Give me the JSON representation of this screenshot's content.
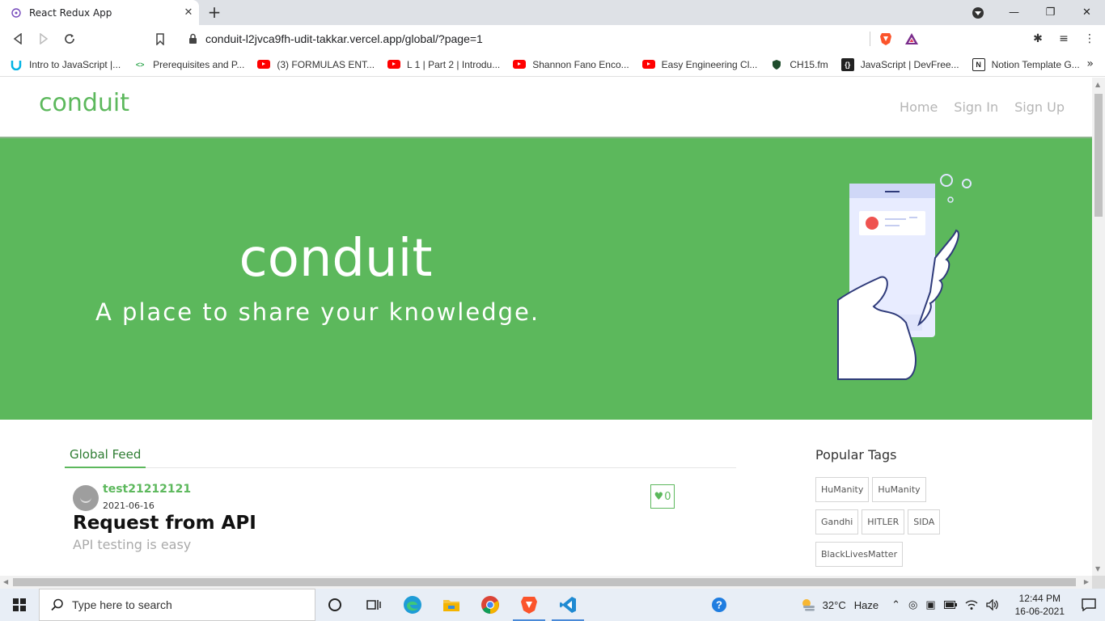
{
  "browser": {
    "tab_title": "React Redux App",
    "url": "conduit-l2jvca9fh-udit-takkar.vercel.app/global/?page=1",
    "bookmarks": [
      {
        "label": "Intro to JavaScript |...",
        "icon": "udacity-icon"
      },
      {
        "label": "Prerequisites and P...",
        "icon": "code-icon"
      },
      {
        "label": "(3) FORMULAS ENT...",
        "icon": "youtube-icon"
      },
      {
        "label": "L 1 | Part 2 | Introdu...",
        "icon": "youtube-icon"
      },
      {
        "label": "Shannon Fano Enco...",
        "icon": "youtube-icon"
      },
      {
        "label": "Easy Engineering Cl...",
        "icon": "youtube-icon"
      },
      {
        "label": "CH15.fm",
        "icon": "shield-icon"
      },
      {
        "label": "JavaScript | DevFree...",
        "icon": "devfreebooks-icon"
      },
      {
        "label": "Notion Template G...",
        "icon": "notion-icon"
      }
    ]
  },
  "app": {
    "brand": "conduit",
    "nav": [
      "Home",
      "Sign In",
      "Sign Up"
    ],
    "hero": {
      "title": "conduit",
      "subtitle": "A place to share your knowledge."
    },
    "feed": {
      "tab_label": "Global Feed",
      "articles": [
        {
          "author": "test21212121",
          "date": "2021-06-16",
          "title": "Request from API",
          "description": "API testing is easy",
          "likes": "0"
        }
      ]
    },
    "sidebar": {
      "title": "Popular Tags",
      "tags": [
        "HuManity",
        "HuManity",
        "Gandhi",
        "HITLER",
        "SIDA",
        "BlackLivesMatter"
      ]
    }
  },
  "taskbar": {
    "search_placeholder": "Type here to search",
    "weather_temp": "32°C",
    "weather_text": "Haze",
    "time": "12:44 PM",
    "date": "16-06-2021"
  },
  "colors": {
    "accent": "#5cb85c"
  }
}
